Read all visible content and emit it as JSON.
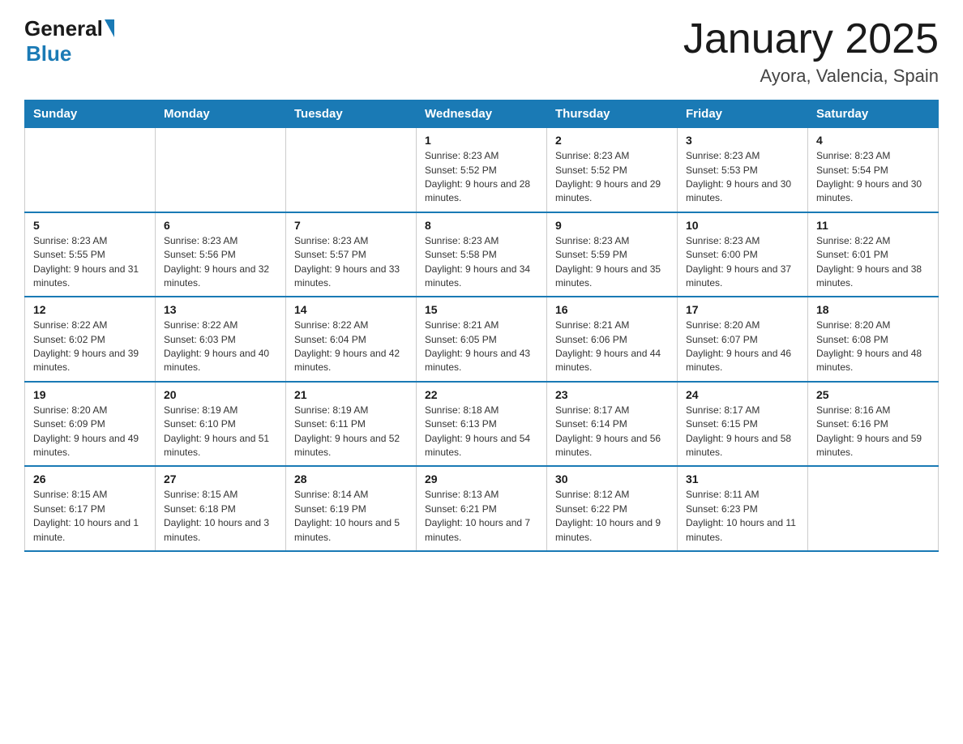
{
  "header": {
    "logo": {
      "general": "General",
      "blue": "Blue"
    },
    "title": "January 2025",
    "subtitle": "Ayora, Valencia, Spain"
  },
  "days_of_week": [
    "Sunday",
    "Monday",
    "Tuesday",
    "Wednesday",
    "Thursday",
    "Friday",
    "Saturday"
  ],
  "weeks": [
    [
      {
        "day": "",
        "info": ""
      },
      {
        "day": "",
        "info": ""
      },
      {
        "day": "",
        "info": ""
      },
      {
        "day": "1",
        "info": "Sunrise: 8:23 AM\nSunset: 5:52 PM\nDaylight: 9 hours and 28 minutes."
      },
      {
        "day": "2",
        "info": "Sunrise: 8:23 AM\nSunset: 5:52 PM\nDaylight: 9 hours and 29 minutes."
      },
      {
        "day": "3",
        "info": "Sunrise: 8:23 AM\nSunset: 5:53 PM\nDaylight: 9 hours and 30 minutes."
      },
      {
        "day": "4",
        "info": "Sunrise: 8:23 AM\nSunset: 5:54 PM\nDaylight: 9 hours and 30 minutes."
      }
    ],
    [
      {
        "day": "5",
        "info": "Sunrise: 8:23 AM\nSunset: 5:55 PM\nDaylight: 9 hours and 31 minutes."
      },
      {
        "day": "6",
        "info": "Sunrise: 8:23 AM\nSunset: 5:56 PM\nDaylight: 9 hours and 32 minutes."
      },
      {
        "day": "7",
        "info": "Sunrise: 8:23 AM\nSunset: 5:57 PM\nDaylight: 9 hours and 33 minutes."
      },
      {
        "day": "8",
        "info": "Sunrise: 8:23 AM\nSunset: 5:58 PM\nDaylight: 9 hours and 34 minutes."
      },
      {
        "day": "9",
        "info": "Sunrise: 8:23 AM\nSunset: 5:59 PM\nDaylight: 9 hours and 35 minutes."
      },
      {
        "day": "10",
        "info": "Sunrise: 8:23 AM\nSunset: 6:00 PM\nDaylight: 9 hours and 37 minutes."
      },
      {
        "day": "11",
        "info": "Sunrise: 8:22 AM\nSunset: 6:01 PM\nDaylight: 9 hours and 38 minutes."
      }
    ],
    [
      {
        "day": "12",
        "info": "Sunrise: 8:22 AM\nSunset: 6:02 PM\nDaylight: 9 hours and 39 minutes."
      },
      {
        "day": "13",
        "info": "Sunrise: 8:22 AM\nSunset: 6:03 PM\nDaylight: 9 hours and 40 minutes."
      },
      {
        "day": "14",
        "info": "Sunrise: 8:22 AM\nSunset: 6:04 PM\nDaylight: 9 hours and 42 minutes."
      },
      {
        "day": "15",
        "info": "Sunrise: 8:21 AM\nSunset: 6:05 PM\nDaylight: 9 hours and 43 minutes."
      },
      {
        "day": "16",
        "info": "Sunrise: 8:21 AM\nSunset: 6:06 PM\nDaylight: 9 hours and 44 minutes."
      },
      {
        "day": "17",
        "info": "Sunrise: 8:20 AM\nSunset: 6:07 PM\nDaylight: 9 hours and 46 minutes."
      },
      {
        "day": "18",
        "info": "Sunrise: 8:20 AM\nSunset: 6:08 PM\nDaylight: 9 hours and 48 minutes."
      }
    ],
    [
      {
        "day": "19",
        "info": "Sunrise: 8:20 AM\nSunset: 6:09 PM\nDaylight: 9 hours and 49 minutes."
      },
      {
        "day": "20",
        "info": "Sunrise: 8:19 AM\nSunset: 6:10 PM\nDaylight: 9 hours and 51 minutes."
      },
      {
        "day": "21",
        "info": "Sunrise: 8:19 AM\nSunset: 6:11 PM\nDaylight: 9 hours and 52 minutes."
      },
      {
        "day": "22",
        "info": "Sunrise: 8:18 AM\nSunset: 6:13 PM\nDaylight: 9 hours and 54 minutes."
      },
      {
        "day": "23",
        "info": "Sunrise: 8:17 AM\nSunset: 6:14 PM\nDaylight: 9 hours and 56 minutes."
      },
      {
        "day": "24",
        "info": "Sunrise: 8:17 AM\nSunset: 6:15 PM\nDaylight: 9 hours and 58 minutes."
      },
      {
        "day": "25",
        "info": "Sunrise: 8:16 AM\nSunset: 6:16 PM\nDaylight: 9 hours and 59 minutes."
      }
    ],
    [
      {
        "day": "26",
        "info": "Sunrise: 8:15 AM\nSunset: 6:17 PM\nDaylight: 10 hours and 1 minute."
      },
      {
        "day": "27",
        "info": "Sunrise: 8:15 AM\nSunset: 6:18 PM\nDaylight: 10 hours and 3 minutes."
      },
      {
        "day": "28",
        "info": "Sunrise: 8:14 AM\nSunset: 6:19 PM\nDaylight: 10 hours and 5 minutes."
      },
      {
        "day": "29",
        "info": "Sunrise: 8:13 AM\nSunset: 6:21 PM\nDaylight: 10 hours and 7 minutes."
      },
      {
        "day": "30",
        "info": "Sunrise: 8:12 AM\nSunset: 6:22 PM\nDaylight: 10 hours and 9 minutes."
      },
      {
        "day": "31",
        "info": "Sunrise: 8:11 AM\nSunset: 6:23 PM\nDaylight: 10 hours and 11 minutes."
      },
      {
        "day": "",
        "info": ""
      }
    ]
  ]
}
